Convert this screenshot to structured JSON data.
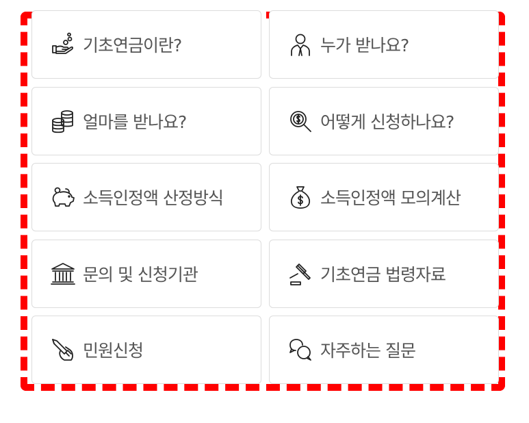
{
  "menu": {
    "items": [
      {
        "label": "기초연금이란?",
        "icon": "hand-coins-icon"
      },
      {
        "label": "누가 받나요?",
        "icon": "person-suit-icon"
      },
      {
        "label": "얼마를 받나요?",
        "icon": "coin-stack-icon"
      },
      {
        "label": "어떻게 신청하나요?",
        "icon": "dollar-search-icon"
      },
      {
        "label": "소득인정액 산정방식",
        "icon": "piggy-bank-icon"
      },
      {
        "label": "소득인정액 모의계산",
        "icon": "money-bag-icon"
      },
      {
        "label": "문의 및 신청기관",
        "icon": "institution-building-icon"
      },
      {
        "label": "기초연금 법령자료",
        "icon": "gavel-icon"
      },
      {
        "label": "민원신청",
        "icon": "pen-hand-icon"
      },
      {
        "label": "자주하는 질문",
        "icon": "chat-bubbles-icon"
      }
    ]
  },
  "highlight_color": "#ff0000"
}
